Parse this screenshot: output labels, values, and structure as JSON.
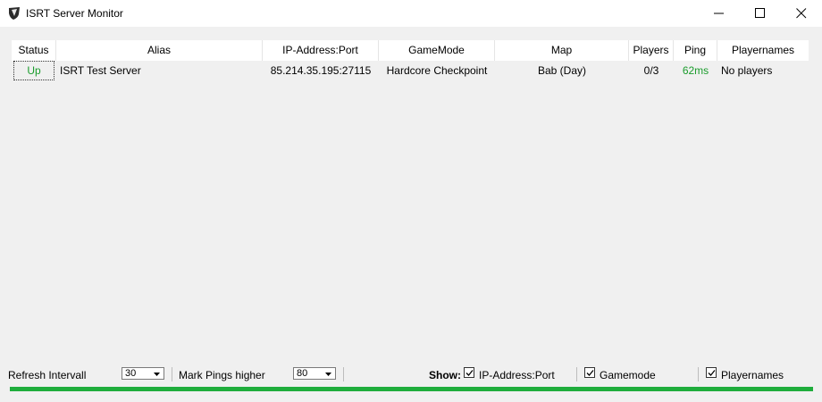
{
  "window": {
    "title": "ISRT Server Monitor",
    "icon": "insurgency-shield-icon"
  },
  "table": {
    "columns": [
      "Status",
      "Alias",
      "IP-Address:Port",
      "GameMode",
      "Map",
      "Players",
      "Ping",
      "Playernames"
    ],
    "rows": [
      {
        "status": "Up",
        "alias": "ISRT Test Server",
        "ip": "85.214.35.195:27115",
        "gamemode": "Hardcore Checkpoint",
        "map": "Bab (Day)",
        "players": "0/3",
        "ping": "62ms",
        "playernames": "No players"
      }
    ]
  },
  "controls": {
    "refresh_label": "Refresh Intervall",
    "refresh_value": "30",
    "ping_label": "Mark Pings higher",
    "ping_value": "80",
    "show_label": "Show:",
    "show_ip_label": "IP-Address:Port",
    "show_ip_checked": true,
    "show_gamemode_label": "Gamemode",
    "show_gamemode_checked": true,
    "show_playernames_label": "Playernames",
    "show_playernames_checked": true
  },
  "refresh_progress_fraction": 1.0,
  "colors": {
    "status_up": "#1a9c2c",
    "ping_ok": "#1a9c2c",
    "progress": "#1fad3c"
  }
}
